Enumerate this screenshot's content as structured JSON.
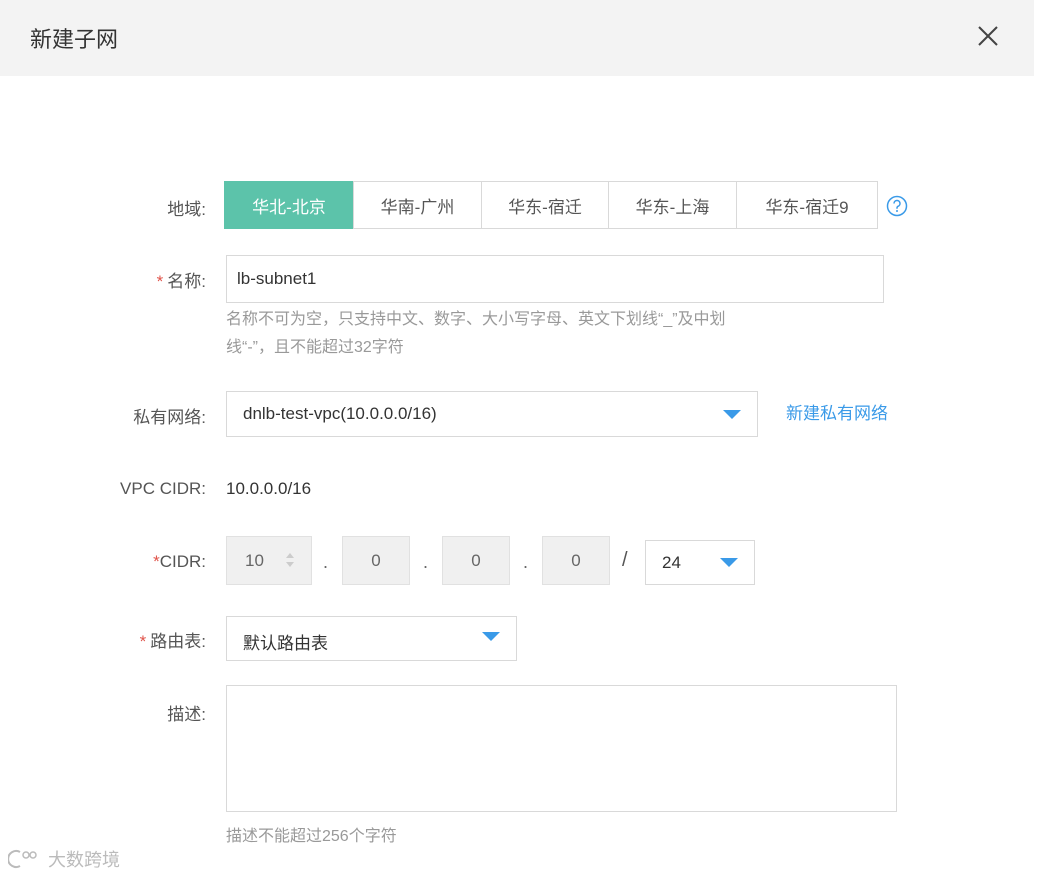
{
  "dialog": {
    "title": "新建子网"
  },
  "labels": {
    "region": "地域:",
    "name": "名称:",
    "vpc": "私有网络:",
    "vpc_cidr": "VPC CIDR:",
    "cidr": "CIDR:",
    "route_table": "路由表:",
    "description": "描述:"
  },
  "required_mark": "*",
  "regions": [
    {
      "label": "华北-北京",
      "active": true
    },
    {
      "label": "华南-广州",
      "active": false
    },
    {
      "label": "华东-宿迁",
      "active": false
    },
    {
      "label": "华东-上海",
      "active": false
    },
    {
      "label": "华东-宿迁9",
      "active": false
    }
  ],
  "name": {
    "value": "lb-subnet1",
    "hint_line1": "名称不可为空，只支持中文、数字、大小写字母、英文下划线“_”及中划",
    "hint_line2": "线“-”，且不能超过32字符"
  },
  "vpc": {
    "selected": "dnlb-test-vpc(10.0.0.0/16)",
    "create_link": "新建私有网络"
  },
  "vpc_cidr": {
    "value": "10.0.0.0/16"
  },
  "cidr": {
    "octet1": "10",
    "octet2": "0",
    "octet3": "0",
    "octet4": "0",
    "separator": ".",
    "slash": "/",
    "mask": "24"
  },
  "route_table": {
    "selected": "默认路由表"
  },
  "description": {
    "value": "",
    "hint": "描述不能超过256个字符"
  },
  "watermark": {
    "text": "大数跨境"
  },
  "colors": {
    "active_region": "#5cc3aa",
    "accent": "#3a9ae8",
    "required": "#e0534a"
  }
}
